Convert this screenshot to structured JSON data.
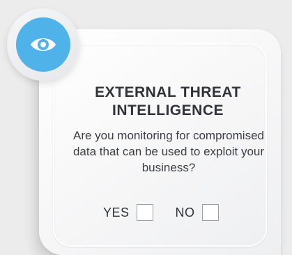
{
  "card": {
    "title": "EXTERNAL THREAT INTELLIGENCE",
    "question": "Are you monitoring for compromised data that can be used to exploit your business?",
    "icon": "eye-icon",
    "accent_color": "#4fb2e8"
  },
  "answers": {
    "yes_label": "YES",
    "no_label": "NO"
  }
}
